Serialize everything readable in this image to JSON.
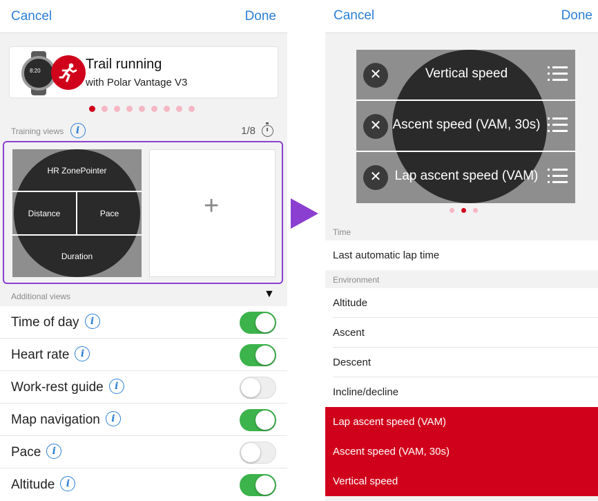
{
  "left": {
    "nav": {
      "cancel": "Cancel",
      "done": "Done"
    },
    "sport": {
      "title": "Trail running",
      "subtitle": "with Polar Vantage V3",
      "watch_time": "8:20"
    },
    "page_dots": {
      "count": 9,
      "active": 0
    },
    "training_views": {
      "label": "Training views",
      "page_counter": "1/8"
    },
    "current_view": {
      "top": "HR ZonePointer",
      "left": "Distance",
      "right": "Pace",
      "bottom": "Duration"
    },
    "add_symbol": "+",
    "arrow_symbol": "▼",
    "additional_views": {
      "label": "Additional views",
      "items": [
        {
          "label": "Time of day",
          "on": true
        },
        {
          "label": "Heart rate",
          "on": true
        },
        {
          "label": "Work-rest guide",
          "on": false
        },
        {
          "label": "Map navigation",
          "on": true
        },
        {
          "label": "Pace",
          "on": false
        },
        {
          "label": "Altitude",
          "on": true
        }
      ]
    }
  },
  "right": {
    "nav": {
      "cancel": "Cancel",
      "done": "Done"
    },
    "fields": [
      "Vertical speed",
      "Ascent speed (VAM, 30s)",
      "Lap ascent speed (VAM)"
    ],
    "page_dots": {
      "count": 3,
      "active": 1
    },
    "sections": [
      {
        "title": "Time",
        "items": [
          "Last automatic lap time"
        ]
      },
      {
        "title": "Environment",
        "items": [
          "Altitude",
          "Ascent",
          "Descent",
          "Incline/decline"
        ]
      }
    ],
    "selected_items": [
      "Lap ascent speed (VAM)",
      "Ascent speed (VAM, 30s)",
      "Vertical speed"
    ]
  },
  "colors": {
    "accent_blue": "#2b7fd6",
    "polar_red": "#d0021b",
    "highlight_purple": "#8b3fd1",
    "toggle_green": "#3cb34b"
  }
}
